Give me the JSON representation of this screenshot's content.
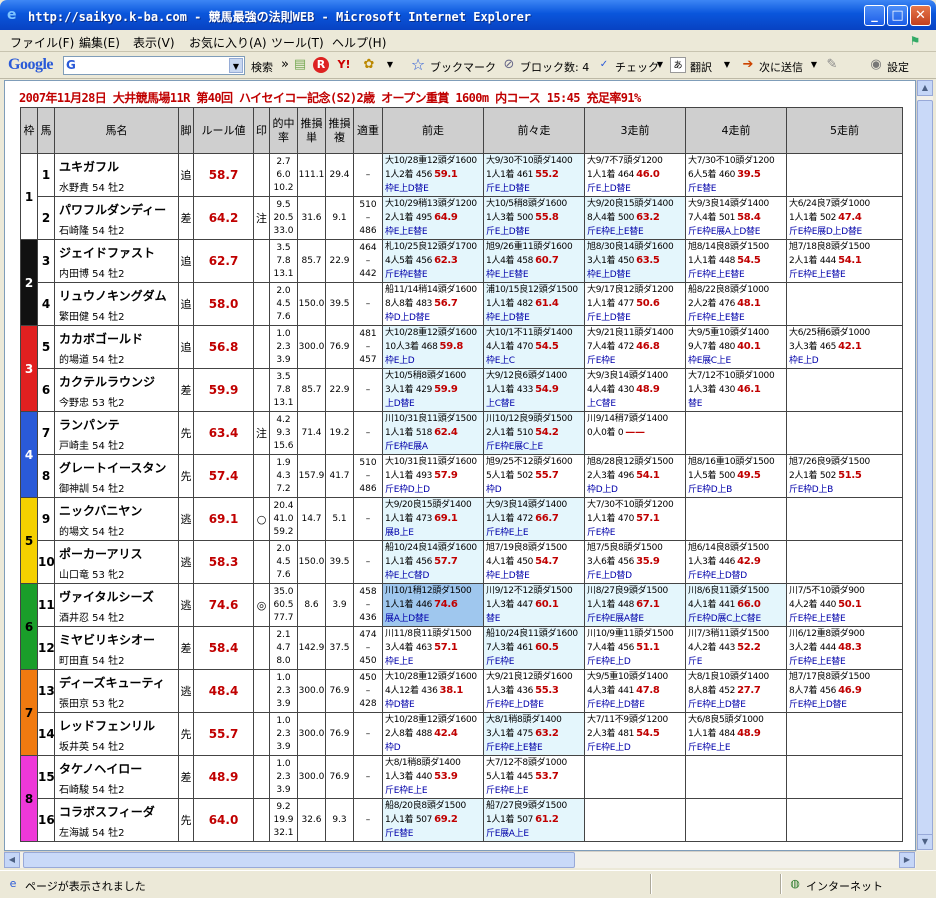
{
  "window": {
    "title": "http://saikyo.k-ba.com - 競馬最強の法則WEB - Microsoft Internet Explorer",
    "minimize": "_",
    "maximize": "□",
    "close": "✕"
  },
  "menu": [
    "ファイル(F)",
    "編集(E)",
    "表示(V)",
    "お気に入り(A)",
    "ツール(T)",
    "ヘルプ(H)"
  ],
  "toolbar": {
    "logo": "Google",
    "search_prefix": "G",
    "search_button": "検索",
    "bookmark": "ブックマーク",
    "block": "ブロック数: 4",
    "check": "チェック",
    "translate": "翻訳",
    "send": "次に送信",
    "settings": "設定"
  },
  "status": {
    "text": "ページが表示されました",
    "zone": "インターネット"
  },
  "race_title": "2007年11月28日 大井競馬場11R 第40回 ハイセイコー記念(S2)2歳 オープン重賞 1600m 内コース 15:45 充足率91%",
  "headers": {
    "waku": "枠",
    "umaban": "馬",
    "name": "馬名",
    "style": "脚",
    "rule": "ルール値",
    "mark": "印",
    "rate": "的中率",
    "tan": "推損単",
    "fuku": "推損複",
    "weight": "適重",
    "r1": "前走",
    "r2": "前々走",
    "r3": "3走前",
    "r4": "4走前",
    "r5": "5走前"
  },
  "waku_colors": [
    "#ffffff",
    "#111111",
    "#e02020",
    "#2a5ad8",
    "#f5d000",
    "#1a9e2a",
    "#f07a10",
    "#ee38d8"
  ],
  "waku_labels": [
    "1",
    "2",
    "3",
    "4",
    "5",
    "6",
    "7",
    "8"
  ],
  "horses": [
    {
      "no": "1",
      "name": "ユキガフル",
      "jockey": "水野貴 54 牡2",
      "style": "追",
      "rule": "58.7",
      "mark": "",
      "rates": [
        "2.7",
        "6.0",
        "10.2"
      ],
      "tan": "111.1",
      "fuku": "29.4",
      "weight": [
        "",
        "–",
        ""
      ],
      "races": [
        {
          "l1": "大10/28重12頭ダ1600",
          "l2": "1人2着 456",
          "val": "59.1",
          "l3": "枠E上D替E",
          "hl": true
        },
        {
          "l1": "大9/30不10頭ダ1400",
          "l2": "1人1着 461",
          "val": "55.2",
          "l3": "斤E上D替E",
          "hl": true
        },
        {
          "l1": "大9/7不7頭ダ1200",
          "l2": "1人1着 464",
          "val": "46.0",
          "l3": "斤E上D替E",
          "hl": false
        },
        {
          "l1": "大7/30不10頭ダ1200",
          "l2": "6人5着 460",
          "val": "39.5",
          "l3": "斤E替E",
          "hl": false
        },
        {
          "l1": "",
          "l2": "",
          "val": "",
          "l3": "",
          "hl": false
        }
      ]
    },
    {
      "no": "2",
      "name": "パワフルダンディー",
      "jockey": "石崎隆 54 牡2",
      "style": "差",
      "rule": "64.2",
      "mark": "注",
      "rates": [
        "9.5",
        "20.5",
        "33.0"
      ],
      "tan": "31.6",
      "fuku": "9.1",
      "weight": [
        "510",
        "–",
        "486"
      ],
      "races": [
        {
          "l1": "大10/29稍13頭ダ1200",
          "l2": "2人1着 495",
          "val": "64.9",
          "l3": "枠E上E替E",
          "hl": true
        },
        {
          "l1": "大10/5稍8頭ダ1600",
          "l2": "1人3着 500",
          "val": "55.8",
          "l3": "斤E上D替E",
          "hl": true
        },
        {
          "l1": "大9/20良15頭ダ1400",
          "l2": "8人4着 500",
          "val": "63.2",
          "l3": "斤E枠E上E替E",
          "hl": true
        },
        {
          "l1": "大9/3良14頭ダ1400",
          "l2": "7人4着 501",
          "val": "58.4",
          "l3": "斤E枠E展A上D替E",
          "hl": false
        },
        {
          "l1": "大6/24良7頭ダ1000",
          "l2": "1人1着 502",
          "val": "47.4",
          "l3": "斤E枠E展D上D替E",
          "hl": false
        }
      ]
    },
    {
      "no": "3",
      "name": "ジェイドファスト",
      "jockey": "内田博 54 牡2",
      "style": "追",
      "rule": "62.7",
      "mark": "",
      "rates": [
        "3.5",
        "7.8",
        "13.1"
      ],
      "tan": "85.7",
      "fuku": "22.9",
      "weight": [
        "464",
        "–",
        "442"
      ],
      "races": [
        {
          "l1": "札10/25良12頭ダ1700",
          "l2": "4人5着 456",
          "val": "62.3",
          "l3": "斤E枠E替E",
          "hl": true
        },
        {
          "l1": "旭9/26重11頭ダ1600",
          "l2": "1人4着 458",
          "val": "60.7",
          "l3": "枠E上E替E",
          "hl": true
        },
        {
          "l1": "旭8/30良14頭ダ1600",
          "l2": "3人1着 450",
          "val": "63.5",
          "l3": "枠E上D替E",
          "hl": true
        },
        {
          "l1": "旭8/14良8頭ダ1500",
          "l2": "1人1着 448",
          "val": "54.5",
          "l3": "斤E枠E上E替E",
          "hl": false
        },
        {
          "l1": "旭7/18良8頭ダ1500",
          "l2": "2人1着 444",
          "val": "54.1",
          "l3": "斤E枠E上E替E",
          "hl": false
        }
      ]
    },
    {
      "no": "4",
      "name": "リュウノキングダム",
      "jockey": "繁田健 54 牡2",
      "style": "追",
      "rule": "58.0",
      "mark": "",
      "rates": [
        "2.0",
        "4.5",
        "7.6"
      ],
      "tan": "150.0",
      "fuku": "39.5",
      "weight": [
        "",
        "–",
        ""
      ],
      "races": [
        {
          "l1": "船11/14稍14頭ダ1600",
          "l2": "8人8着 483",
          "val": "56.7",
          "l3": "枠D上D替E",
          "hl": false
        },
        {
          "l1": "浦10/15良12頭ダ1500",
          "l2": "1人1着 482",
          "val": "61.4",
          "l3": "枠E上D替E",
          "hl": true
        },
        {
          "l1": "大9/17良12頭ダ1200",
          "l2": "1人1着 477",
          "val": "50.6",
          "l3": "斤E上D替E",
          "hl": false
        },
        {
          "l1": "船8/22良8頭ダ1000",
          "l2": "2人2着 476",
          "val": "48.1",
          "l3": "斤E枠E上E替E",
          "hl": false
        },
        {
          "l1": "",
          "l2": "",
          "val": "",
          "l3": "",
          "hl": false
        }
      ]
    },
    {
      "no": "5",
      "name": "カカボゴールド",
      "jockey": "的場道 54 牡2",
      "style": "追",
      "rule": "56.8",
      "mark": "",
      "rates": [
        "1.0",
        "2.3",
        "3.9"
      ],
      "tan": "300.0",
      "fuku": "76.9",
      "weight": [
        "481",
        "–",
        "457"
      ],
      "races": [
        {
          "l1": "大10/28重12頭ダ1600",
          "l2": "10人3着 468",
          "val": "59.8",
          "l3": "枠E上D",
          "hl": true
        },
        {
          "l1": "大10/1不11頭ダ1400",
          "l2": "4人1着 470",
          "val": "54.5",
          "l3": "枠E上C",
          "hl": true
        },
        {
          "l1": "大9/21良11頭ダ1400",
          "l2": "7人4着 472",
          "val": "46.8",
          "l3": "斤E枠E",
          "hl": false
        },
        {
          "l1": "大9/5重10頭ダ1400",
          "l2": "9人7着 480",
          "val": "40.1",
          "l3": "枠E展C上E",
          "hl": false
        },
        {
          "l1": "大6/25稍6頭ダ1000",
          "l2": "3人3着 465",
          "val": "42.1",
          "l3": "枠E上D",
          "hl": false
        }
      ]
    },
    {
      "no": "6",
      "name": "カクテルラウンジ",
      "jockey": "今野忠 53 牝2",
      "style": "差",
      "rule": "59.9",
      "mark": "",
      "rates": [
        "3.5",
        "7.8",
        "13.1"
      ],
      "tan": "85.7",
      "fuku": "22.9",
      "weight": [
        "",
        "–",
        ""
      ],
      "races": [
        {
          "l1": "大10/5稍8頭ダ1600",
          "l2": "3人1着 429",
          "val": "59.9",
          "l3": "上D替E",
          "hl": true
        },
        {
          "l1": "大9/12良6頭ダ1400",
          "l2": "1人1着 433",
          "val": "54.9",
          "l3": "上C替E",
          "hl": true
        },
        {
          "l1": "大9/3良14頭ダ1400",
          "l2": "4人4着 430",
          "val": "48.9",
          "l3": "上C替E",
          "hl": false
        },
        {
          "l1": "大7/12不10頭ダ1000",
          "l2": "1人3着 430",
          "val": "46.1",
          "l3": "替E",
          "hl": false
        },
        {
          "l1": "",
          "l2": "",
          "val": "",
          "l3": "",
          "hl": false
        }
      ]
    },
    {
      "no": "7",
      "name": "ランパンテ",
      "jockey": "戸崎圭 54 牡2",
      "style": "先",
      "rule": "63.4",
      "mark": "注",
      "rates": [
        "4.2",
        "9.3",
        "15.6"
      ],
      "tan": "71.4",
      "fuku": "19.2",
      "weight": [
        "",
        "–",
        ""
      ],
      "races": [
        {
          "l1": "川10/31良11頭ダ1500",
          "l2": "1人1着 518",
          "val": "62.4",
          "l3": "斤E枠E展A",
          "hl": true
        },
        {
          "l1": "川10/12良9頭ダ1500",
          "l2": "2人1着 510",
          "val": "54.2",
          "l3": "斤E枠E展C上E",
          "hl": true
        },
        {
          "l1": "川9/14稍7頭ダ1400",
          "l2": "0人0着 0",
          "val": "——",
          "l3": "",
          "hl": false
        },
        {
          "l1": "",
          "l2": "",
          "val": "",
          "l3": "",
          "hl": false
        },
        {
          "l1": "",
          "l2": "",
          "val": "",
          "l3": "",
          "hl": false
        }
      ]
    },
    {
      "no": "8",
      "name": "グレートイースタン",
      "jockey": "御神訓 54 牡2",
      "style": "先",
      "rule": "57.4",
      "mark": "",
      "rates": [
        "1.9",
        "4.3",
        "7.2"
      ],
      "tan": "157.9",
      "fuku": "41.7",
      "weight": [
        "510",
        "–",
        "486"
      ],
      "races": [
        {
          "l1": "大10/31良11頭ダ1600",
          "l2": "1人1着 493",
          "val": "57.9",
          "l3": "斤E枠D上D",
          "hl": false
        },
        {
          "l1": "旭9/25不12頭ダ1600",
          "l2": "5人1着 502",
          "val": "55.7",
          "l3": "枠D",
          "hl": false
        },
        {
          "l1": "旭8/28良12頭ダ1500",
          "l2": "2人3着 496",
          "val": "54.1",
          "l3": "枠D上D",
          "hl": false
        },
        {
          "l1": "旭8/16重10頭ダ1500",
          "l2": "1人5着 500",
          "val": "49.5",
          "l3": "斤E枠D上B",
          "hl": false
        },
        {
          "l1": "旭7/26良9頭ダ1500",
          "l2": "2人1着 502",
          "val": "51.5",
          "l3": "斤E枠D上B",
          "hl": false
        }
      ]
    },
    {
      "no": "9",
      "name": "ニックバニヤン",
      "jockey": "的場文 54 牡2",
      "style": "逃",
      "rule": "69.1",
      "mark": "○",
      "rates": [
        "20.4",
        "41.0",
        "59.2"
      ],
      "tan": "14.7",
      "fuku": "5.1",
      "weight": [
        "",
        "–",
        ""
      ],
      "races": [
        {
          "l1": "大9/20良15頭ダ1400",
          "l2": "1人1着 473",
          "val": "69.1",
          "l3": "展B上E",
          "hl": true
        },
        {
          "l1": "大9/3良14頭ダ1400",
          "l2": "1人1着 472",
          "val": "66.7",
          "l3": "斤E枠E上E",
          "hl": true
        },
        {
          "l1": "大7/30不10頭ダ1200",
          "l2": "1人1着 470",
          "val": "57.1",
          "l3": "斤E枠E",
          "hl": false
        },
        {
          "l1": "",
          "l2": "",
          "val": "",
          "l3": "",
          "hl": false
        },
        {
          "l1": "",
          "l2": "",
          "val": "",
          "l3": "",
          "hl": false
        }
      ]
    },
    {
      "no": "10",
      "name": "ポーカーアリス",
      "jockey": "山口竜 53 牝2",
      "style": "逃",
      "rule": "58.3",
      "mark": "",
      "rates": [
        "2.0",
        "4.5",
        "7.6"
      ],
      "tan": "150.0",
      "fuku": "39.5",
      "weight": [
        "",
        "–",
        ""
      ],
      "races": [
        {
          "l1": "船10/24良14頭ダ1600",
          "l2": "1人1着 456",
          "val": "57.7",
          "l3": "枠E上C替D",
          "hl": true
        },
        {
          "l1": "旭7/19良8頭ダ1500",
          "l2": "4人1着 450",
          "val": "54.7",
          "l3": "枠E上D替E",
          "hl": false
        },
        {
          "l1": "旭7/5良8頭ダ1500",
          "l2": "3人6着 456",
          "val": "35.9",
          "l3": "斤E上D替D",
          "hl": false
        },
        {
          "l1": "旭6/14良8頭ダ1500",
          "l2": "1人3着 446",
          "val": "42.9",
          "l3": "斤E枠E上D替D",
          "hl": false
        },
        {
          "l1": "",
          "l2": "",
          "val": "",
          "l3": "",
          "hl": false
        }
      ]
    },
    {
      "no": "11",
      "name": "ヴァイタルシーズ",
      "jockey": "酒井忍 54 牡2",
      "style": "逃",
      "rule": "74.6",
      "mark": "◎",
      "rates": [
        "35.0",
        "60.5",
        "77.7"
      ],
      "tan": "8.6",
      "fuku": "3.9",
      "weight": [
        "458",
        "–",
        "436"
      ],
      "races": [
        {
          "l1": "川10/1稍12頭ダ1500",
          "l2": "1人1着 446",
          "val": "74.6",
          "l3": "展A上D替E",
          "hl": false,
          "blue": true
        },
        {
          "l1": "川9/12不12頭ダ1500",
          "l2": "1人3着 447",
          "val": "60.1",
          "l3": "替E",
          "hl": true
        },
        {
          "l1": "川8/27良9頭ダ1500",
          "l2": "1人1着 448",
          "val": "67.1",
          "l3": "斤E枠E展A替E",
          "hl": true
        },
        {
          "l1": "川8/6良11頭ダ1500",
          "l2": "4人1着 441",
          "val": "66.0",
          "l3": "斤E枠D展C上C替E",
          "hl": true
        },
        {
          "l1": "川7/5不10頭ダ900",
          "l2": "4人2着 440",
          "val": "50.1",
          "l3": "斤E枠E上E替E",
          "hl": false
        }
      ]
    },
    {
      "no": "12",
      "name": "ミヤビリキシオー",
      "jockey": "町田直 54 牡2",
      "style": "差",
      "rule": "58.4",
      "mark": "",
      "rates": [
        "2.1",
        "4.7",
        "8.0"
      ],
      "tan": "142.9",
      "fuku": "37.5",
      "weight": [
        "474",
        "–",
        "450"
      ],
      "races": [
        {
          "l1": "川11/8良11頭ダ1500",
          "l2": "3人4着 463",
          "val": "57.1",
          "l3": "枠E上E",
          "hl": false
        },
        {
          "l1": "船10/24良11頭ダ1600",
          "l2": "7人3着 461",
          "val": "60.5",
          "l3": "斤E枠E",
          "hl": true
        },
        {
          "l1": "川10/9重11頭ダ1500",
          "l2": "7人4着 456",
          "val": "51.1",
          "l3": "斤E枠E上D",
          "hl": false
        },
        {
          "l1": "川7/3稍11頭ダ1500",
          "l2": "4人2着 443",
          "val": "52.2",
          "l3": "斤E",
          "hl": false
        },
        {
          "l1": "川6/12重8頭ダ900",
          "l2": "3人2着 444",
          "val": "48.3",
          "l3": "斤E枠E上E替E",
          "hl": false
        }
      ]
    },
    {
      "no": "13",
      "name": "ディーズキューティ",
      "jockey": "張田京 53 牝2",
      "style": "逃",
      "rule": "48.4",
      "mark": "",
      "rates": [
        "1.0",
        "2.3",
        "3.9"
      ],
      "tan": "300.0",
      "fuku": "76.9",
      "weight": [
        "450",
        "–",
        "428"
      ],
      "races": [
        {
          "l1": "大10/28重12頭ダ1600",
          "l2": "4人12着 436",
          "val": "38.1",
          "l3": "枠D替E",
          "hl": false
        },
        {
          "l1": "大9/21良12頭ダ1600",
          "l2": "1人3着 436",
          "val": "55.3",
          "l3": "斤E枠E上D替E",
          "hl": false
        },
        {
          "l1": "大9/5重10頭ダ1400",
          "l2": "4人3着 441",
          "val": "47.8",
          "l3": "斤E枠E上D替E",
          "hl": false
        },
        {
          "l1": "大8/1良10頭ダ1400",
          "l2": "8人8着 452",
          "val": "27.7",
          "l3": "斤E枠E上D替E",
          "hl": false
        },
        {
          "l1": "旭7/17良8頭ダ1500",
          "l2": "8人7着 456",
          "val": "46.9",
          "l3": "斤E枠E上D替E",
          "hl": false
        }
      ]
    },
    {
      "no": "14",
      "name": "レッドフェンリル",
      "jockey": "坂井英 54 牡2",
      "style": "先",
      "rule": "55.7",
      "mark": "",
      "rates": [
        "1.0",
        "2.3",
        "3.9"
      ],
      "tan": "300.0",
      "fuku": "76.9",
      "weight": [
        "",
        "–",
        ""
      ],
      "races": [
        {
          "l1": "大10/28重12頭ダ1600",
          "l2": "2人8着 488",
          "val": "42.4",
          "l3": "枠D",
          "hl": false
        },
        {
          "l1": "大8/1稍8頭ダ1400",
          "l2": "3人1着 475",
          "val": "63.2",
          "l3": "斤E枠E上E替E",
          "hl": true
        },
        {
          "l1": "大7/11不9頭ダ1200",
          "l2": "2人3着 481",
          "val": "54.5",
          "l3": "斤E枠E上D",
          "hl": false
        },
        {
          "l1": "大6/8良5頭ダ1000",
          "l2": "1人1着 484",
          "val": "48.9",
          "l3": "斤E枠E上E",
          "hl": false
        },
        {
          "l1": "",
          "l2": "",
          "val": "",
          "l3": "",
          "hl": false
        }
      ]
    },
    {
      "no": "15",
      "name": "タケノヘイロー",
      "jockey": "石崎駿 54 牡2",
      "style": "差",
      "rule": "48.9",
      "mark": "",
      "rates": [
        "1.0",
        "2.3",
        "3.9"
      ],
      "tan": "300.0",
      "fuku": "76.9",
      "weight": [
        "",
        "–",
        ""
      ],
      "races": [
        {
          "l1": "大8/1稍8頭ダ1400",
          "l2": "1人3着 440",
          "val": "53.9",
          "l3": "斤E枠E上E",
          "hl": false
        },
        {
          "l1": "大7/12不8頭ダ1000",
          "l2": "5人1着 445",
          "val": "53.7",
          "l3": "斤E枠E上E",
          "hl": false
        },
        {
          "l1": "",
          "l2": "",
          "val": "",
          "l3": "",
          "hl": false
        },
        {
          "l1": "",
          "l2": "",
          "val": "",
          "l3": "",
          "hl": false
        },
        {
          "l1": "",
          "l2": "",
          "val": "",
          "l3": "",
          "hl": false
        }
      ]
    },
    {
      "no": "16",
      "name": "コラボスフィーダ",
      "jockey": "左海誠 54 牡2",
      "style": "先",
      "rule": "64.0",
      "mark": "",
      "rates": [
        "9.2",
        "19.9",
        "32.1"
      ],
      "tan": "32.6",
      "fuku": "9.3",
      "weight": [
        "",
        "–",
        ""
      ],
      "races": [
        {
          "l1": "船8/20良8頭ダ1500",
          "l2": "1人1着 507",
          "val": "69.2",
          "l3": "斤E替E",
          "hl": true
        },
        {
          "l1": "船7/27良9頭ダ1500",
          "l2": "1人1着 507",
          "val": "61.2",
          "l3": "斤E展A上E",
          "hl": true
        },
        {
          "l1": "",
          "l2": "",
          "val": "",
          "l3": "",
          "hl": false
        },
        {
          "l1": "",
          "l2": "",
          "val": "",
          "l3": "",
          "hl": false
        },
        {
          "l1": "",
          "l2": "",
          "val": "",
          "l3": "",
          "hl": false
        }
      ]
    }
  ]
}
